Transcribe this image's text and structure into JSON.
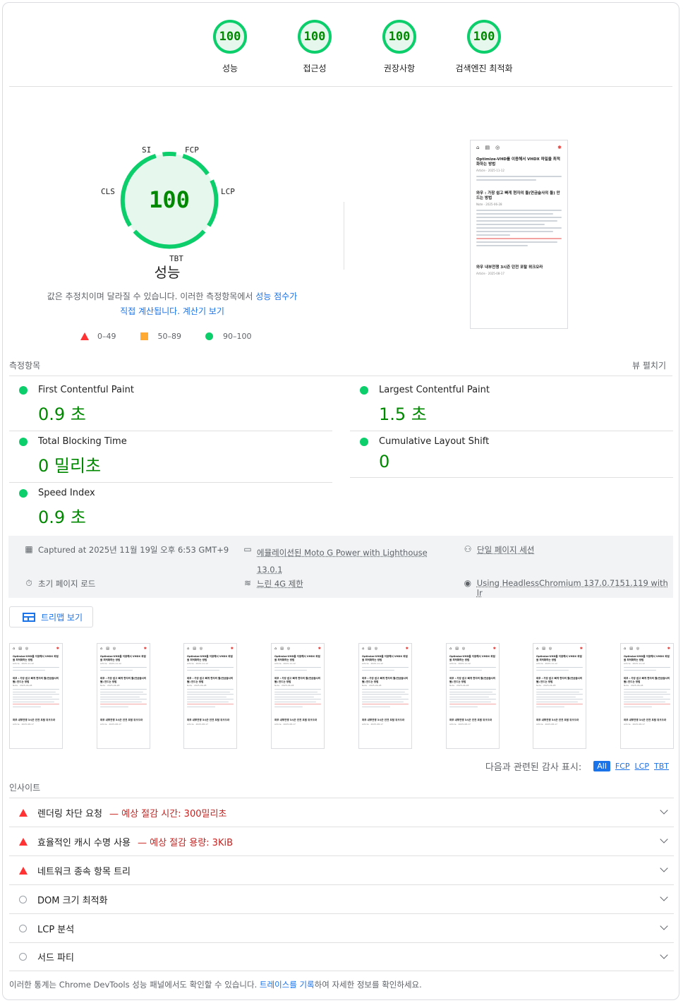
{
  "top_gauges": [
    {
      "score": "100",
      "label": "성능"
    },
    {
      "score": "100",
      "label": "접근성"
    },
    {
      "score": "100",
      "label": "권장사항"
    },
    {
      "score": "100",
      "label": "검색엔진 최적화"
    }
  ],
  "main_gauge": {
    "score": "100",
    "title": "성능",
    "labels": {
      "si": "SI",
      "fcp": "FCP",
      "lcp": "LCP",
      "tbt": "TBT",
      "cls": "CLS"
    }
  },
  "description": {
    "text1": "값은 추정치이며 달라질 수 있습니다. 이러한 측정항목에서 ",
    "link1": "성능 점수가",
    "link2": "직접 계산됩니다.",
    "link3": "계산기 보기"
  },
  "legend": [
    {
      "range": "0–49"
    },
    {
      "range": "50–89"
    },
    {
      "range": "90–100"
    }
  ],
  "screenshot": {
    "post1_title": "Optimize-VHD를 이용해서 VHDX 파일을 최적화하는 방법",
    "post1_meta": "Article · 2025-11-12",
    "post2_title": "와우 : 가장 쉽고 빠게 현자의 돌(연금술사의 돌) 만드는 방법",
    "post2_meta": "Note · 2025-06-28",
    "post3_title": "와우 내부전쟁 3시즌 던전 포탈 위크오라",
    "post3_meta": "Article · 2025-08-17"
  },
  "metrics": {
    "section_label": "측정항목",
    "expand_label": "뷰 펼치기",
    "fcp": {
      "name": "First Contentful Paint",
      "value": "0.9 초"
    },
    "lcp": {
      "name": "Largest Contentful Paint",
      "value": "1.5 초"
    },
    "tbt": {
      "name": "Total Blocking Time",
      "value": "0 밀리초"
    },
    "cls": {
      "name": "Cumulative Layout Shift",
      "value": "0"
    },
    "si": {
      "name": "Speed Index",
      "value": "0.9 초"
    }
  },
  "runtime": {
    "captured": "Captured at 2025년 11월 19일 오후 6:53 GMT+9",
    "device": "에뮬레이션된 Moto G Power with Lighthouse",
    "device_version": "13.0.1",
    "session": "단일 페이지 세션",
    "load": "초기 페이지 로드",
    "network": "느린 4G 제한",
    "browser": "Using HeadlessChromium 137.0.7151.119 with lr"
  },
  "treemap_label": "트리맵 보기",
  "filter": {
    "label": "다음과 관련된 감사 표시:",
    "chips": [
      "All",
      "FCP",
      "LCP",
      "TBT"
    ]
  },
  "insights": {
    "section_label": "인사이트",
    "items": [
      {
        "title": "렌더링 차단 요청",
        "extra": "— 예상 절감 시간: 300밀리초"
      },
      {
        "title": "효율적인 캐시 수명 사용",
        "extra": "— 예상 절감 용량: 3KiB"
      },
      {
        "title": "네트워크 종속 항목 트리",
        "extra": ""
      },
      {
        "title": "DOM 크기 최적화",
        "extra": ""
      },
      {
        "title": "LCP 분석",
        "extra": ""
      },
      {
        "title": "서드 파티",
        "extra": ""
      }
    ]
  },
  "footer": {
    "text1": "이러한 통계는 Chrome DevTools 성능 패널에서도 확인할 수 있습니다. ",
    "link": "트레이스를 기록",
    "text2": "하여 자세한 정보를 확인하세요."
  },
  "colors": {
    "pass": "#0cce6b",
    "pass_text": "#008800",
    "fail": "#ff3333",
    "average": "#ffaa33",
    "link": "#1a73e8"
  }
}
